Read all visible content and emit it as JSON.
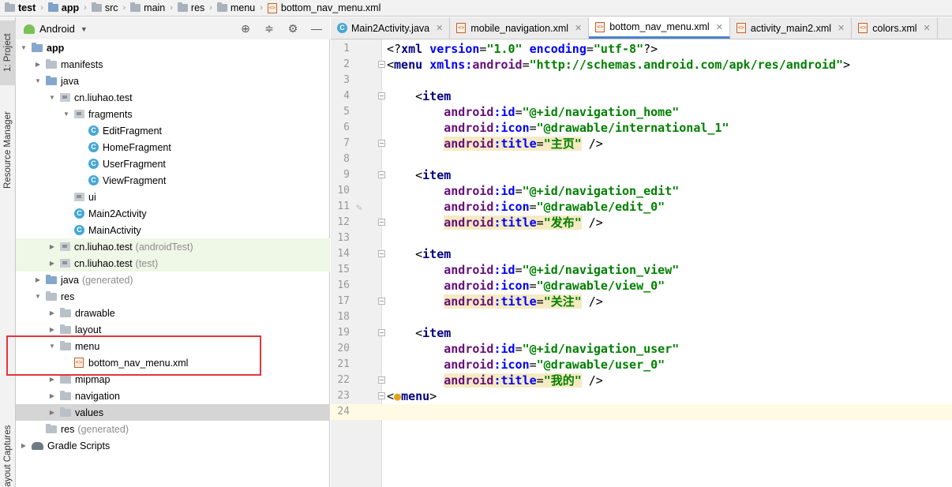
{
  "breadcrumb": {
    "items": [
      "test",
      "app",
      "src",
      "main",
      "res",
      "menu",
      "bottom_nav_menu.xml"
    ]
  },
  "toolstrip": {
    "project_tab": "1: Project",
    "resource_tab": "Resource Manager",
    "layout_tab": "Layout Captures"
  },
  "project_panel": {
    "view_mode": "Android",
    "tree": [
      {
        "label": "app",
        "suffix": ""
      },
      {
        "label": "manifests",
        "suffix": ""
      },
      {
        "label": "java",
        "suffix": ""
      },
      {
        "label": "cn.liuhao.test",
        "suffix": ""
      },
      {
        "label": "fragments",
        "suffix": ""
      },
      {
        "label": "EditFragment",
        "suffix": ""
      },
      {
        "label": "HomeFragment",
        "suffix": ""
      },
      {
        "label": "UserFragment",
        "suffix": ""
      },
      {
        "label": "ViewFragment",
        "suffix": ""
      },
      {
        "label": "ui",
        "suffix": ""
      },
      {
        "label": "Main2Activity",
        "suffix": ""
      },
      {
        "label": "MainActivity",
        "suffix": ""
      },
      {
        "label": "cn.liuhao.test",
        "suffix": "(androidTest)"
      },
      {
        "label": "cn.liuhao.test",
        "suffix": "(test)"
      },
      {
        "label": "java",
        "suffix": "(generated)"
      },
      {
        "label": "res",
        "suffix": ""
      },
      {
        "label": "drawable",
        "suffix": ""
      },
      {
        "label": "layout",
        "suffix": ""
      },
      {
        "label": "menu",
        "suffix": ""
      },
      {
        "label": "bottom_nav_menu.xml",
        "suffix": ""
      },
      {
        "label": "mipmap",
        "suffix": ""
      },
      {
        "label": "navigation",
        "suffix": ""
      },
      {
        "label": "values",
        "suffix": ""
      },
      {
        "label": "res",
        "suffix": "(generated)"
      },
      {
        "label": "Gradle Scripts",
        "suffix": ""
      }
    ]
  },
  "tabs": [
    {
      "label": "Main2Activity.java"
    },
    {
      "label": "mobile_navigation.xml"
    },
    {
      "label": "bottom_nav_menu.xml"
    },
    {
      "label": "activity_main2.xml"
    },
    {
      "label": "colors.xml"
    }
  ],
  "editor": {
    "active_file": "bottom_nav_menu.xml",
    "line_numbers": [
      "1",
      "2",
      "3",
      "4",
      "5",
      "6",
      "7",
      "8",
      "9",
      "10",
      "11",
      "12",
      "13",
      "14",
      "15",
      "16",
      "17",
      "18",
      "19",
      "20",
      "21",
      "22",
      "23",
      "24"
    ],
    "xml_decl": {
      "version": "\"1.0\"",
      "encoding": "\"utf-8\""
    },
    "namespace": "\"http://schemas.android.com/apk/res/android\"",
    "items": [
      {
        "id": "\"@+id/navigation_home\"",
        "icon": "\"@drawable/international_1\"",
        "title": "\"主页\""
      },
      {
        "id": "\"@+id/navigation_edit\"",
        "icon": "\"@drawable/edit_0\"",
        "title": "\"发布\""
      },
      {
        "id": "\"@+id/navigation_view\"",
        "icon": "\"@drawable/view_0\"",
        "title": "\"关注\""
      },
      {
        "id": "\"@+id/navigation_user\"",
        "icon": "\"@drawable/user_0\"",
        "title": "\"我的\""
      }
    ]
  },
  "colors": {
    "tag": "#000080",
    "attribute": "#660e7a",
    "value": "#008000",
    "highlight_box": "#e5353b",
    "active_tab_underline": "#4b83cb"
  }
}
